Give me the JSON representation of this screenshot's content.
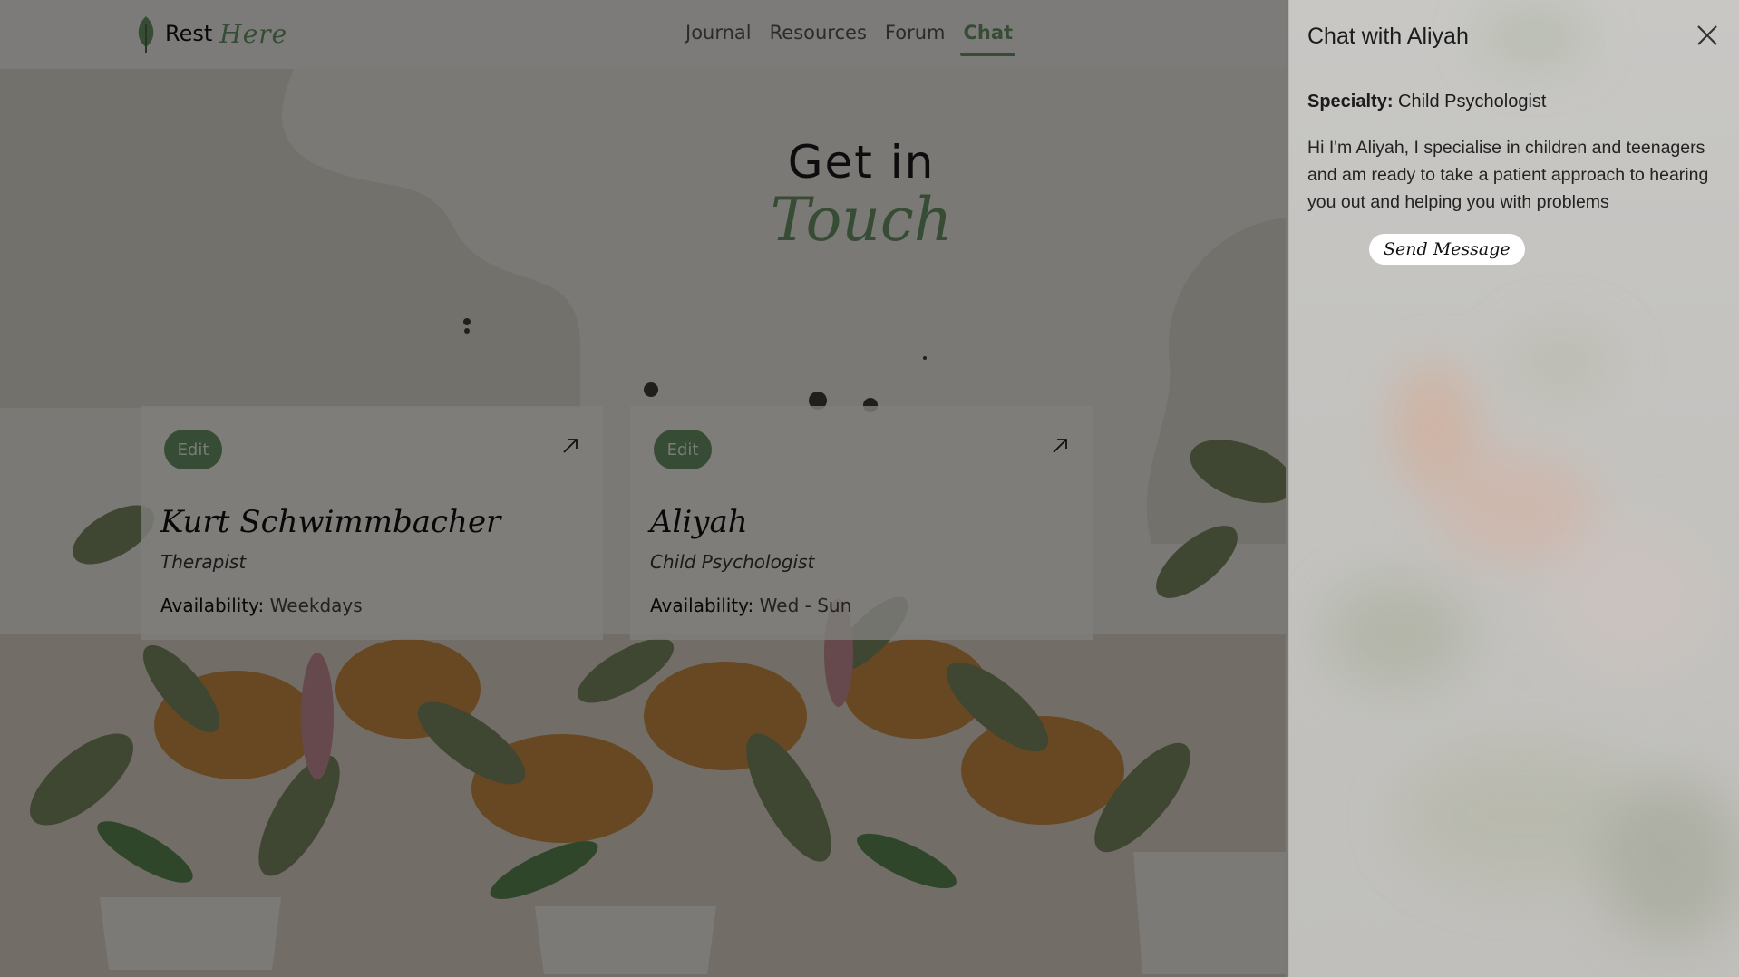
{
  "logo": {
    "text1": "Rest",
    "text2": "Here"
  },
  "nav": {
    "items": [
      {
        "label": "Journal"
      },
      {
        "label": "Resources"
      },
      {
        "label": "Forum"
      },
      {
        "label": "Chat",
        "active": true
      }
    ]
  },
  "hero": {
    "line1": "Get in",
    "line2": "Touch"
  },
  "cards": [
    {
      "edit_label": "Edit",
      "name": "Kurt Schwimmbacher",
      "role": "Therapist",
      "availability_label": "Availability:",
      "availability_value": "Weekdays"
    },
    {
      "edit_label": "Edit",
      "name": "Aliyah",
      "role": "Child Psychologist",
      "availability_label": "Availability:",
      "availability_value": "Wed - Sun"
    }
  ],
  "panel": {
    "title": "Chat with Aliyah",
    "specialty_label": "Specialty:",
    "specialty_value": "Child Psychologist",
    "bio": "Hi I'm Aliyah, I specialise in children and teenagers and am ready to take a patient approach to hearing you out and helping you with problems",
    "send_label": "Send Message"
  },
  "colors": {
    "accent": "#6d9566",
    "overlay": "rgba(0,0,0,0.49)"
  },
  "icons": {
    "logo": "leaf-icon",
    "card_link": "arrow-up-right-icon",
    "close": "close-icon"
  }
}
